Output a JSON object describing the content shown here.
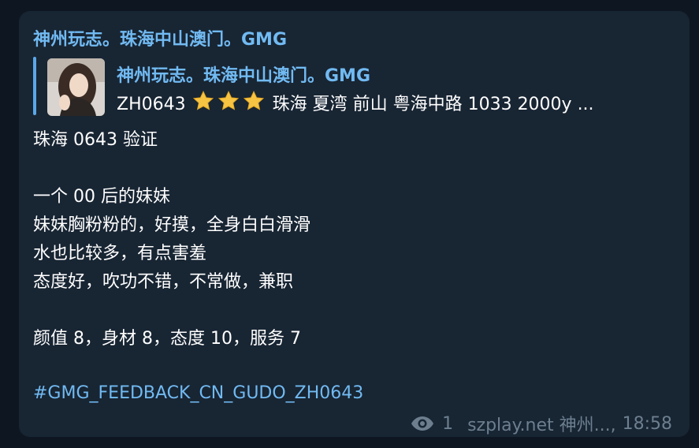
{
  "message": {
    "sender": "神州玩志。珠海中山澳门。GMG",
    "reply": {
      "author": "神州玩志。珠海中山澳门。GMG",
      "code": "ZH0643",
      "stars": 3,
      "preview": "珠海 夏湾 前山 粤海中路 1033 2000y  ..."
    },
    "lines": [
      "珠海 0643 验证",
      "",
      "一个 00 后的妹妹",
      "妹妹胸粉粉的，好摸，全身白白滑滑",
      "水也比较多，有点害羞",
      "态度好，吹功不错，不常做，兼职",
      "",
      "颜值 8，身材 8，态度 10，服务 7",
      ""
    ],
    "hashtag": "#GMG_FEEDBACK_CN_GUDO_ZH0643",
    "views": "1",
    "signature": "szplay.net 神州...,",
    "time": "18:58"
  },
  "icons": {
    "views": "eye-icon",
    "rating": "star-icon"
  },
  "colors": {
    "background": "#0e1621",
    "bubble": "#182533",
    "accent": "#71baf2",
    "meta": "#6d7f8f",
    "star": "#f6c343"
  }
}
